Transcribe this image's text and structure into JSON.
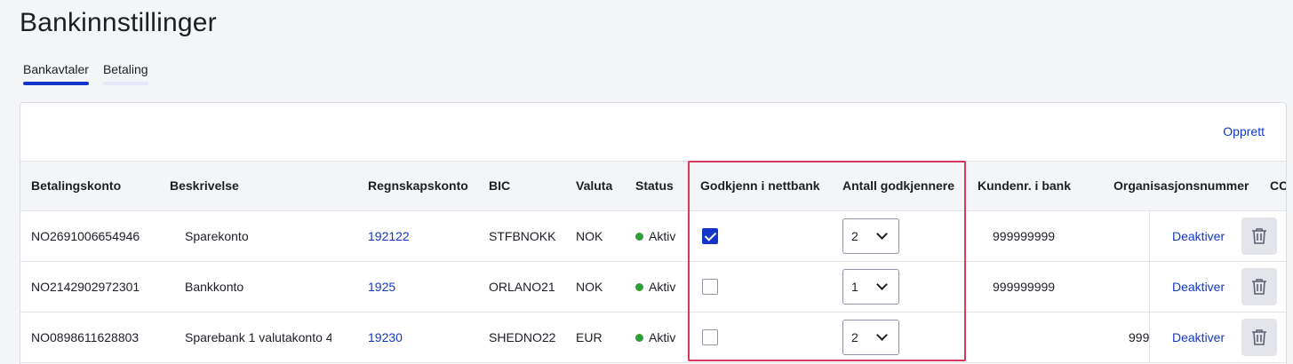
{
  "page": {
    "title": "Bankinnstillinger"
  },
  "tabs": [
    {
      "label": "Bankavtaler",
      "active": true
    },
    {
      "label": "Betaling",
      "active": false
    }
  ],
  "card": {
    "create_label": "Opprett"
  },
  "columns": {
    "betalingskonto": "Betalingskonto",
    "beskrivelse": "Beskrivelse",
    "regnskapskonto": "Regnskapskonto",
    "bic": "BIC",
    "valuta": "Valuta",
    "status": "Status",
    "godkjenn": "Godkjenn i nettbank",
    "antall": "Antall godkjennere",
    "kundenr": "Kundenr. i bank",
    "orgnr": "Organisasjonsnummer",
    "cc": "CC"
  },
  "rows": [
    {
      "account": "NO2691006654946",
      "description": "Sparekonto",
      "ledger": "192122",
      "bic": "STFBNOKK",
      "currency": "NOK",
      "status": "Aktiv",
      "approve_in_netbank": true,
      "approvers": "2",
      "customer_no": "999999999",
      "org_no": "",
      "deactivate_label": "Deaktiver"
    },
    {
      "account": "NO2142902972301",
      "description": "Bankkonto",
      "ledger": "1925",
      "bic": "ORLANO21",
      "currency": "NOK",
      "status": "Aktiv",
      "approve_in_netbank": false,
      "approvers": "1",
      "customer_no": "999999999",
      "org_no": "",
      "deactivate_label": "Deaktiver"
    },
    {
      "account": "NO0898611628803",
      "description": "Sparebank 1 valutakonto 4",
      "ledger": "19230",
      "bic": "SHEDNO22",
      "currency": "EUR",
      "status": "Aktiv",
      "approve_in_netbank": false,
      "approvers": "2",
      "customer_no": "",
      "org_no": "999",
      "deactivate_label": "Deaktiver"
    }
  ],
  "colors": {
    "accent": "#1336c9",
    "status_active": "#2e9e3a",
    "highlight": "#d9385a"
  }
}
